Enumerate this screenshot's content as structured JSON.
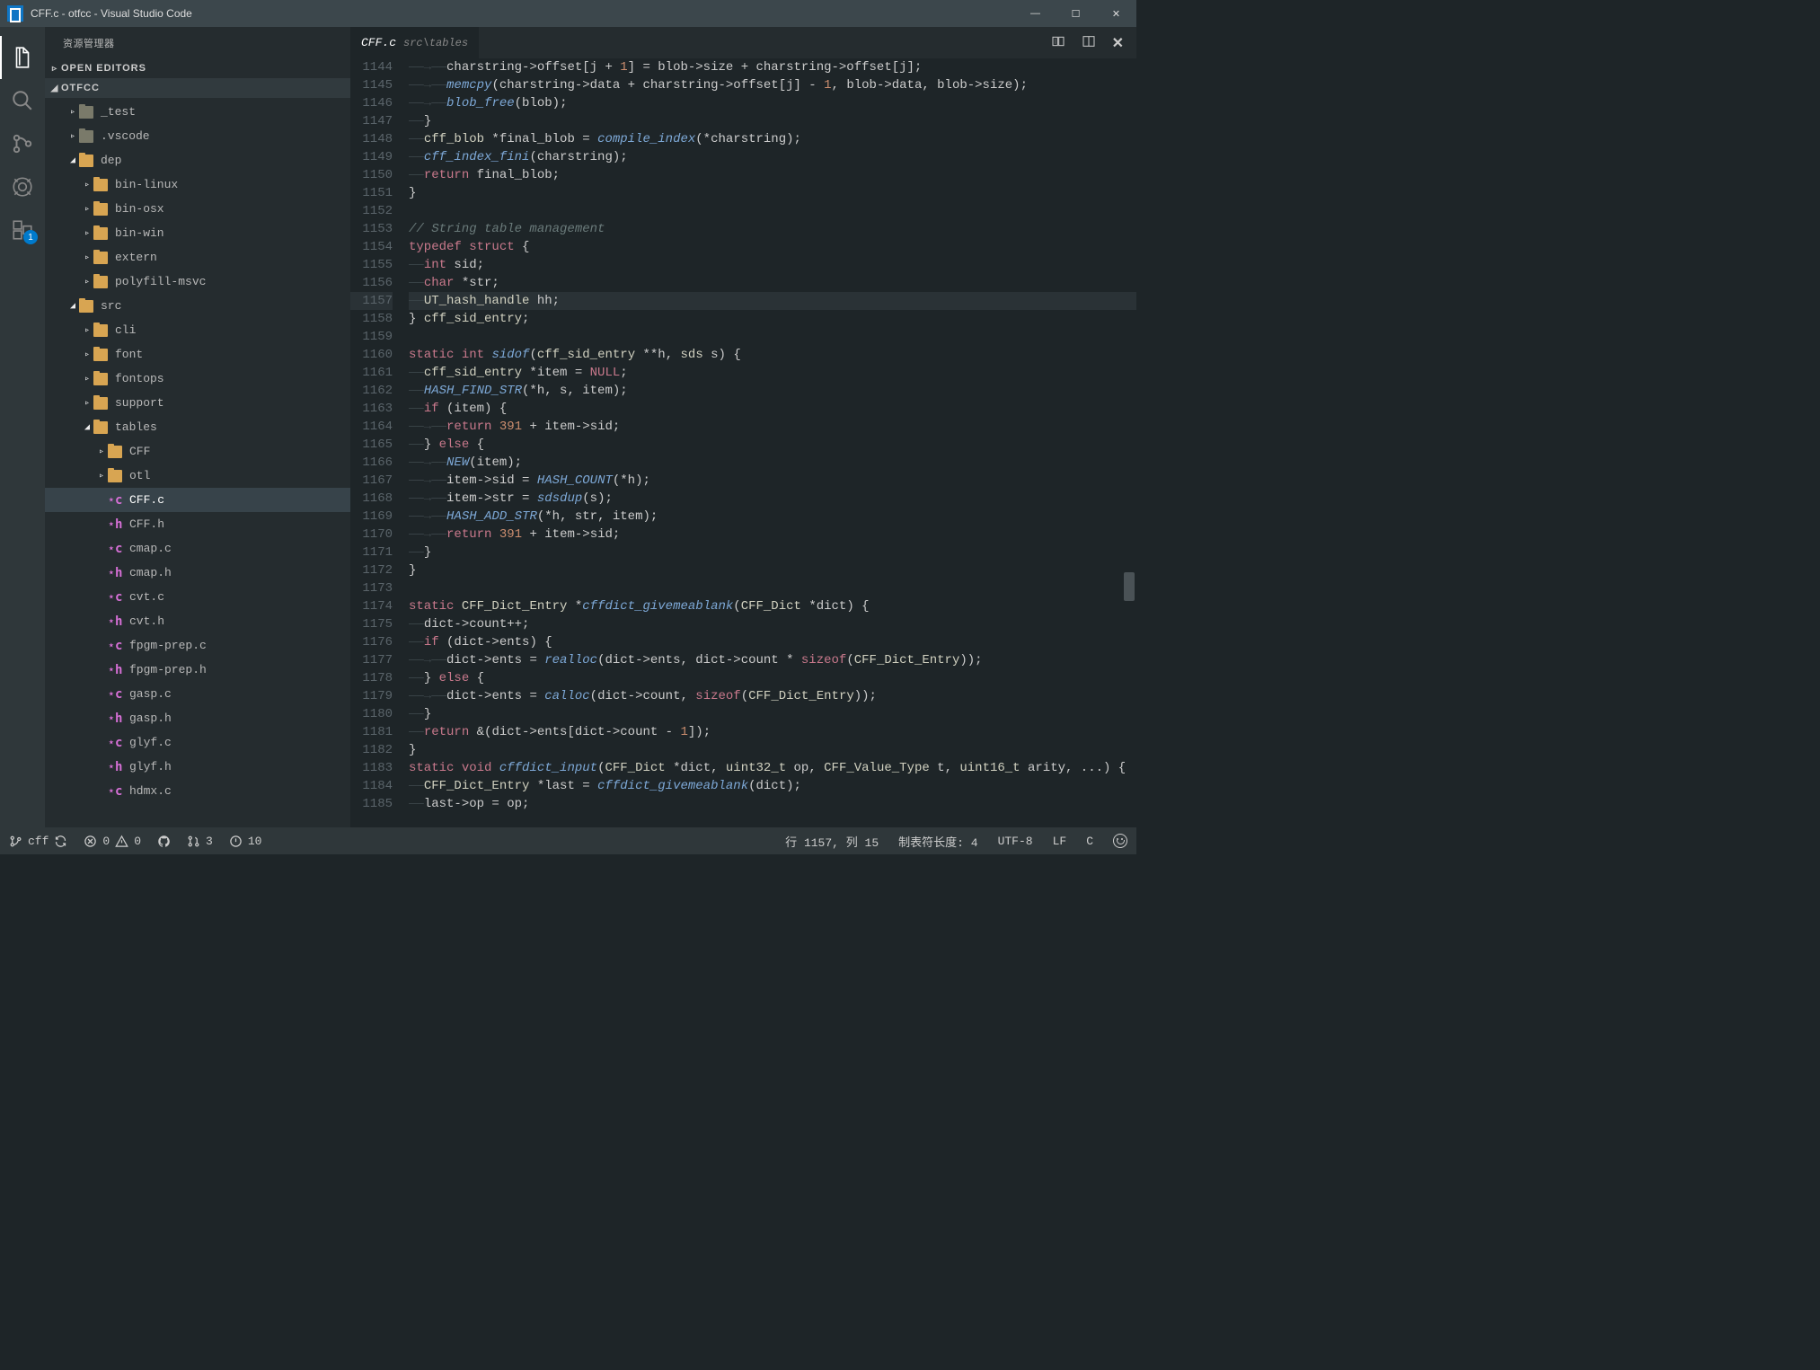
{
  "window": {
    "title": "CFF.c - otfcc - Visual Studio Code"
  },
  "activity": {
    "badge": "1"
  },
  "sidebar": {
    "title": "资源管理器",
    "sections": {
      "open_editors": "OPEN EDITORS",
      "workspace": "OTFCC"
    },
    "tree": [
      {
        "depth": 0,
        "type": "folder",
        "dark": true,
        "expand": "▹",
        "label": "_test"
      },
      {
        "depth": 0,
        "type": "folder",
        "dark": true,
        "expand": "▹",
        "label": ".vscode"
      },
      {
        "depth": 0,
        "type": "folder",
        "expand": "◢",
        "label": "dep"
      },
      {
        "depth": 1,
        "type": "folder",
        "expand": "▹",
        "label": "bin-linux"
      },
      {
        "depth": 1,
        "type": "folder",
        "expand": "▹",
        "label": "bin-osx"
      },
      {
        "depth": 1,
        "type": "folder",
        "expand": "▹",
        "label": "bin-win"
      },
      {
        "depth": 1,
        "type": "folder",
        "expand": "▹",
        "label": "extern"
      },
      {
        "depth": 1,
        "type": "folder",
        "expand": "▹",
        "label": "polyfill-msvc"
      },
      {
        "depth": 0,
        "type": "folder",
        "expand": "◢",
        "label": "src"
      },
      {
        "depth": 1,
        "type": "folder",
        "expand": "▹",
        "label": "cli"
      },
      {
        "depth": 1,
        "type": "folder",
        "expand": "▹",
        "label": "font"
      },
      {
        "depth": 1,
        "type": "folder",
        "expand": "▹",
        "label": "fontops"
      },
      {
        "depth": 1,
        "type": "folder",
        "expand": "▹",
        "label": "support"
      },
      {
        "depth": 1,
        "type": "folder",
        "expand": "◢",
        "label": "tables"
      },
      {
        "depth": 2,
        "type": "folder",
        "expand": "▹",
        "label": "CFF"
      },
      {
        "depth": 2,
        "type": "folder",
        "expand": "▹",
        "label": "otl"
      },
      {
        "depth": 2,
        "type": "c",
        "label": "CFF.c",
        "active": true
      },
      {
        "depth": 2,
        "type": "h",
        "label": "CFF.h"
      },
      {
        "depth": 2,
        "type": "c",
        "label": "cmap.c"
      },
      {
        "depth": 2,
        "type": "h",
        "label": "cmap.h"
      },
      {
        "depth": 2,
        "type": "c",
        "label": "cvt.c"
      },
      {
        "depth": 2,
        "type": "h",
        "label": "cvt.h"
      },
      {
        "depth": 2,
        "type": "c",
        "label": "fpgm-prep.c"
      },
      {
        "depth": 2,
        "type": "h",
        "label": "fpgm-prep.h"
      },
      {
        "depth": 2,
        "type": "c",
        "label": "gasp.c"
      },
      {
        "depth": 2,
        "type": "h",
        "label": "gasp.h"
      },
      {
        "depth": 2,
        "type": "c",
        "label": "glyf.c"
      },
      {
        "depth": 2,
        "type": "h",
        "label": "glyf.h"
      },
      {
        "depth": 2,
        "type": "c",
        "label": "hdmx.c"
      }
    ]
  },
  "tab": {
    "name": "CFF.c",
    "path": "src\\tables"
  },
  "code": {
    "start": 1144,
    "highlight": 1157,
    "lines": [
      "        charstring->offset[j + 1] = blob->size + charstring->offset[j];",
      "        memcpy(charstring->data + charstring->offset[j] - 1, blob->data, blob->size);",
      "        blob_free(blob);",
      "    }",
      "    cff_blob *final_blob = compile_index(*charstring);",
      "    cff_index_fini(charstring);",
      "    return final_blob;",
      "}",
      "",
      "// String table management",
      "typedef struct {",
      "    int sid;",
      "    char *str;",
      "    UT_hash_handle hh;",
      "} cff_sid_entry;",
      "",
      "static int sidof(cff_sid_entry **h, sds s) {",
      "    cff_sid_entry *item = NULL;",
      "    HASH_FIND_STR(*h, s, item);",
      "    if (item) {",
      "        return 391 + item->sid;",
      "    } else {",
      "        NEW(item);",
      "        item->sid = HASH_COUNT(*h);",
      "        item->str = sdsdup(s);",
      "        HASH_ADD_STR(*h, str, item);",
      "        return 391 + item->sid;",
      "    }",
      "}",
      "",
      "static CFF_Dict_Entry *cffdict_givemeablank(CFF_Dict *dict) {",
      "    dict->count++;",
      "    if (dict->ents) {",
      "        dict->ents = realloc(dict->ents, dict->count * sizeof(CFF_Dict_Entry));",
      "    } else {",
      "        dict->ents = calloc(dict->count, sizeof(CFF_Dict_Entry));",
      "    }",
      "    return &(dict->ents[dict->count - 1]);",
      "}",
      "static void cffdict_input(CFF_Dict *dict, uint32_t op, CFF_Value_Type t, uint16_t arity, ...) {",
      "    CFF_Dict_Entry *last = cffdict_givemeablank(dict);",
      "    last->op = op;"
    ]
  },
  "status": {
    "branch": "cff",
    "errors": "0",
    "warnings": "0",
    "pr": "3",
    "issues": "10",
    "position": "行 1157, 列 15",
    "tabsize": "制表符长度: 4",
    "encoding": "UTF-8",
    "eol": "LF",
    "lang": "C"
  }
}
